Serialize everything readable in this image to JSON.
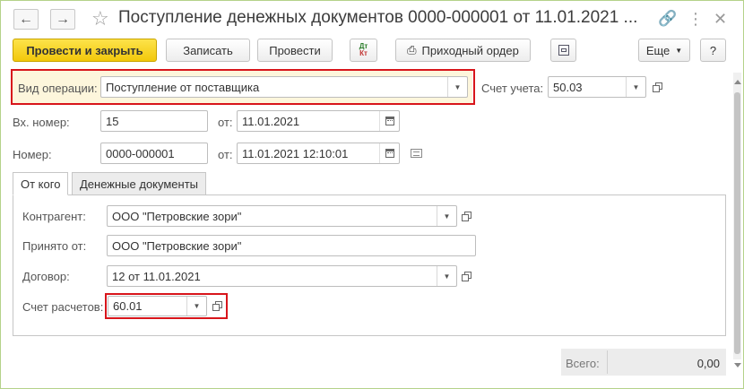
{
  "window": {
    "title": "Поступление денежных документов 0000-000001 от 11.01.2021 ..."
  },
  "titlebar_icons": {
    "back": "arrow-left-icon",
    "forward": "arrow-right-icon",
    "favorite": "star-icon",
    "link": "link-icon",
    "menu": "more-icon",
    "close": "close-icon"
  },
  "toolbar": {
    "post_close": "Провести и закрыть",
    "save": "Записать",
    "post": "Провести",
    "dt": "Дт",
    "kt": "Кт",
    "print_order": "Приходный ордер",
    "more": "Еще",
    "help": "?"
  },
  "header": {
    "operation_label": "Вид операции:",
    "operation_value": "Поступление от поставщика",
    "account_label": "Счет учета:",
    "account_value": "50.03",
    "in_number_label": "Вх. номер:",
    "in_number_value": "15",
    "in_from_label": "от:",
    "in_date_value": "11.01.2021",
    "number_label": "Номер:",
    "number_value": "0000-000001",
    "from_label": "от:",
    "datetime_value": "11.01.2021 12:10:01"
  },
  "tabs": [
    {
      "label": "От кого"
    },
    {
      "label": "Денежные документы"
    }
  ],
  "from_tab": {
    "contractor_label": "Контрагент:",
    "contractor_value": "ООО \"Петровские зори\"",
    "received_from_label": "Принято от:",
    "received_from_value": "ООО \"Петровские зори\"",
    "contract_label": "Договор:",
    "contract_value": "12 от 11.01.2021",
    "settlement_account_label": "Счет расчетов:",
    "settlement_account_value": "60.01"
  },
  "footer": {
    "total_label": "Всего:",
    "total_value": "0,00"
  },
  "colors": {
    "accent_yellow": "#f2c80b",
    "highlight_red": "#d8151b",
    "window_border": "#b5d28a"
  }
}
